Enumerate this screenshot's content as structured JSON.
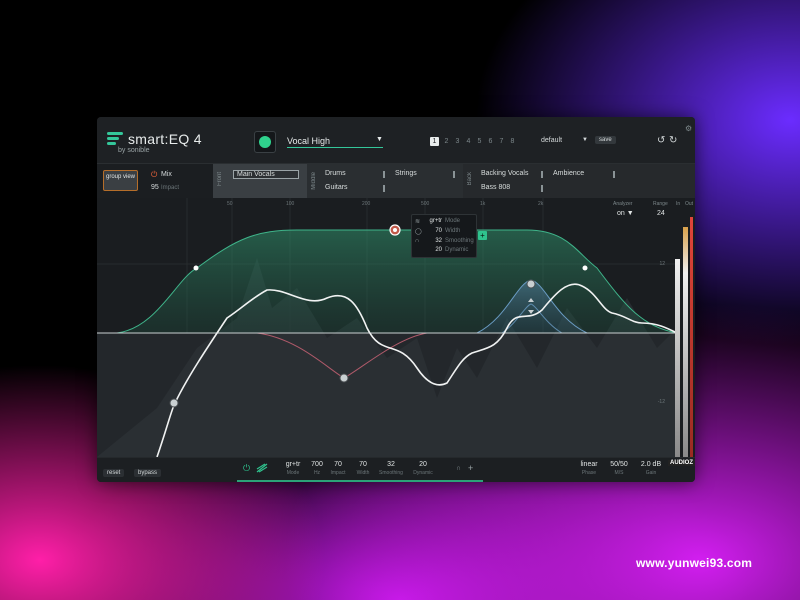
{
  "app": {
    "name": "smart:EQ 4",
    "by": "by sonible",
    "accent": "#2fc38e"
  },
  "header": {
    "preset_name": "Vocal High",
    "slots": [
      "1",
      "2",
      "3",
      "4",
      "5",
      "6",
      "7",
      "8"
    ],
    "active_slot": "1",
    "profile": "default",
    "save_label": "save",
    "undo_icon": "undo-icon",
    "redo_icon": "redo-icon"
  },
  "group": {
    "group_view_label": "group view",
    "mix_label": "Mix",
    "mix_value": "95",
    "mix_sub": "Impact",
    "sections": {
      "front": {
        "label": "Front",
        "tracks": [
          "Main Vocals"
        ]
      },
      "middle": {
        "label": "Middle",
        "tracks": [
          "Drums",
          "Strings",
          "Guitars"
        ]
      },
      "back": {
        "label": "Back",
        "tracks": [
          "Backing Vocals",
          "Ambience",
          "Bass 808"
        ]
      }
    }
  },
  "graph": {
    "freq_labels": [
      "50",
      "100",
      "200",
      "500",
      "1k",
      "2k",
      "5k"
    ],
    "db_labels": [
      "12",
      "0",
      "-12"
    ],
    "analyzer_label": "Analyzer",
    "analyzer_value": "on",
    "range_label": "Range",
    "range_value": "24",
    "in_label": "In",
    "out_label": "Out"
  },
  "band_popup": {
    "rows": [
      {
        "icon": "shape-icon",
        "value": "gr+tr",
        "label": "Mode"
      },
      {
        "icon": "width-icon",
        "value": "70",
        "label": "Width"
      },
      {
        "icon": "smooth-icon",
        "value": "32",
        "label": "Smoothing"
      },
      {
        "icon": "dynamic-icon",
        "value": "20",
        "label": "Dynamic"
      }
    ],
    "add_label": "+"
  },
  "bottom": {
    "reset_label": "reset",
    "bypass_label": "bypass",
    "params": [
      {
        "value": "gr+tr",
        "label": "Mode"
      },
      {
        "value": "700",
        "label": "Hz"
      },
      {
        "value": "70",
        "label": "Impact"
      },
      {
        "value": "70",
        "label": "Width"
      },
      {
        "value": "32",
        "label": "Smoothing"
      },
      {
        "value": "20",
        "label": "Dynamic"
      }
    ],
    "phase_value": "linear",
    "phase_label": "Phase",
    "mix_value": "50/50",
    "mix_label": "M/S",
    "gain_value": "2.0 dB",
    "gain_label": "Gain",
    "badge": "AUDIOZ"
  },
  "watermark": "www.yunwei93.com"
}
